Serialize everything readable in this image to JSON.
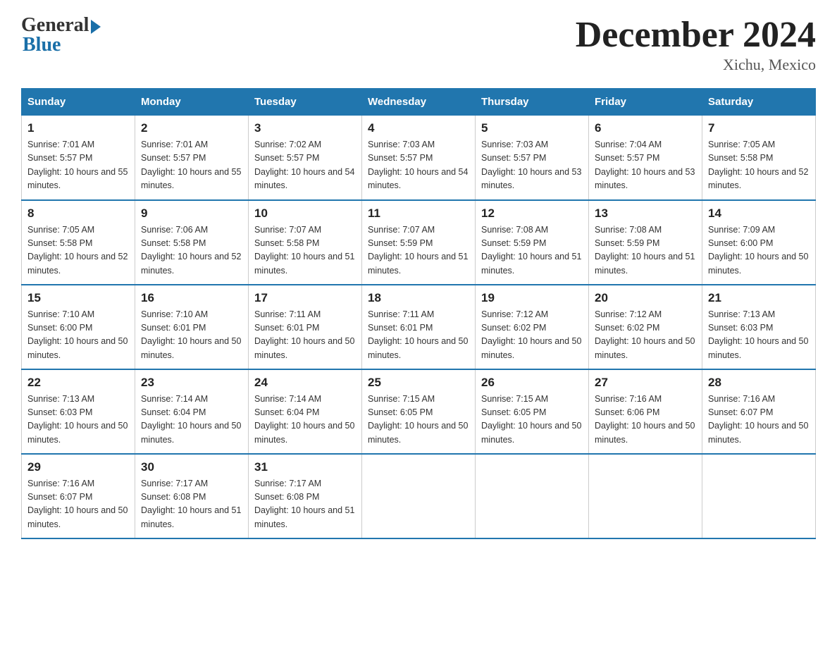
{
  "header": {
    "logo_general": "General",
    "logo_blue": "Blue",
    "month_title": "December 2024",
    "location": "Xichu, Mexico"
  },
  "days_of_week": [
    "Sunday",
    "Monday",
    "Tuesday",
    "Wednesday",
    "Thursday",
    "Friday",
    "Saturday"
  ],
  "weeks": [
    [
      {
        "day": "1",
        "sunrise": "7:01 AM",
        "sunset": "5:57 PM",
        "daylight": "10 hours and 55 minutes."
      },
      {
        "day": "2",
        "sunrise": "7:01 AM",
        "sunset": "5:57 PM",
        "daylight": "10 hours and 55 minutes."
      },
      {
        "day": "3",
        "sunrise": "7:02 AM",
        "sunset": "5:57 PM",
        "daylight": "10 hours and 54 minutes."
      },
      {
        "day": "4",
        "sunrise": "7:03 AM",
        "sunset": "5:57 PM",
        "daylight": "10 hours and 54 minutes."
      },
      {
        "day": "5",
        "sunrise": "7:03 AM",
        "sunset": "5:57 PM",
        "daylight": "10 hours and 53 minutes."
      },
      {
        "day": "6",
        "sunrise": "7:04 AM",
        "sunset": "5:57 PM",
        "daylight": "10 hours and 53 minutes."
      },
      {
        "day": "7",
        "sunrise": "7:05 AM",
        "sunset": "5:58 PM",
        "daylight": "10 hours and 52 minutes."
      }
    ],
    [
      {
        "day": "8",
        "sunrise": "7:05 AM",
        "sunset": "5:58 PM",
        "daylight": "10 hours and 52 minutes."
      },
      {
        "day": "9",
        "sunrise": "7:06 AM",
        "sunset": "5:58 PM",
        "daylight": "10 hours and 52 minutes."
      },
      {
        "day": "10",
        "sunrise": "7:07 AM",
        "sunset": "5:58 PM",
        "daylight": "10 hours and 51 minutes."
      },
      {
        "day": "11",
        "sunrise": "7:07 AM",
        "sunset": "5:59 PM",
        "daylight": "10 hours and 51 minutes."
      },
      {
        "day": "12",
        "sunrise": "7:08 AM",
        "sunset": "5:59 PM",
        "daylight": "10 hours and 51 minutes."
      },
      {
        "day": "13",
        "sunrise": "7:08 AM",
        "sunset": "5:59 PM",
        "daylight": "10 hours and 51 minutes."
      },
      {
        "day": "14",
        "sunrise": "7:09 AM",
        "sunset": "6:00 PM",
        "daylight": "10 hours and 50 minutes."
      }
    ],
    [
      {
        "day": "15",
        "sunrise": "7:10 AM",
        "sunset": "6:00 PM",
        "daylight": "10 hours and 50 minutes."
      },
      {
        "day": "16",
        "sunrise": "7:10 AM",
        "sunset": "6:01 PM",
        "daylight": "10 hours and 50 minutes."
      },
      {
        "day": "17",
        "sunrise": "7:11 AM",
        "sunset": "6:01 PM",
        "daylight": "10 hours and 50 minutes."
      },
      {
        "day": "18",
        "sunrise": "7:11 AM",
        "sunset": "6:01 PM",
        "daylight": "10 hours and 50 minutes."
      },
      {
        "day": "19",
        "sunrise": "7:12 AM",
        "sunset": "6:02 PM",
        "daylight": "10 hours and 50 minutes."
      },
      {
        "day": "20",
        "sunrise": "7:12 AM",
        "sunset": "6:02 PM",
        "daylight": "10 hours and 50 minutes."
      },
      {
        "day": "21",
        "sunrise": "7:13 AM",
        "sunset": "6:03 PM",
        "daylight": "10 hours and 50 minutes."
      }
    ],
    [
      {
        "day": "22",
        "sunrise": "7:13 AM",
        "sunset": "6:03 PM",
        "daylight": "10 hours and 50 minutes."
      },
      {
        "day": "23",
        "sunrise": "7:14 AM",
        "sunset": "6:04 PM",
        "daylight": "10 hours and 50 minutes."
      },
      {
        "day": "24",
        "sunrise": "7:14 AM",
        "sunset": "6:04 PM",
        "daylight": "10 hours and 50 minutes."
      },
      {
        "day": "25",
        "sunrise": "7:15 AM",
        "sunset": "6:05 PM",
        "daylight": "10 hours and 50 minutes."
      },
      {
        "day": "26",
        "sunrise": "7:15 AM",
        "sunset": "6:05 PM",
        "daylight": "10 hours and 50 minutes."
      },
      {
        "day": "27",
        "sunrise": "7:16 AM",
        "sunset": "6:06 PM",
        "daylight": "10 hours and 50 minutes."
      },
      {
        "day": "28",
        "sunrise": "7:16 AM",
        "sunset": "6:07 PM",
        "daylight": "10 hours and 50 minutes."
      }
    ],
    [
      {
        "day": "29",
        "sunrise": "7:16 AM",
        "sunset": "6:07 PM",
        "daylight": "10 hours and 50 minutes."
      },
      {
        "day": "30",
        "sunrise": "7:17 AM",
        "sunset": "6:08 PM",
        "daylight": "10 hours and 51 minutes."
      },
      {
        "day": "31",
        "sunrise": "7:17 AM",
        "sunset": "6:08 PM",
        "daylight": "10 hours and 51 minutes."
      },
      null,
      null,
      null,
      null
    ]
  ],
  "labels": {
    "sunrise_prefix": "Sunrise: ",
    "sunset_prefix": "Sunset: ",
    "daylight_prefix": "Daylight: "
  }
}
